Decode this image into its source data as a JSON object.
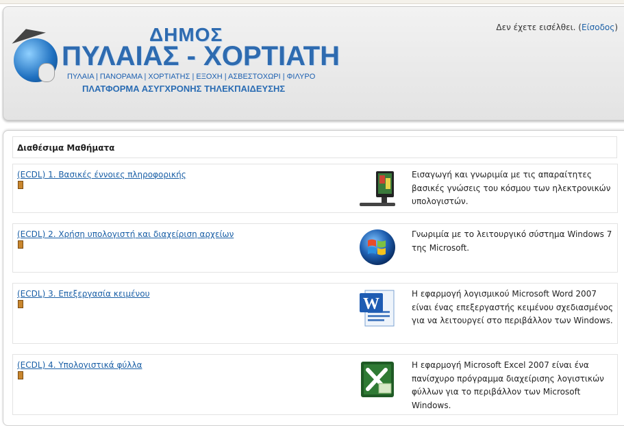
{
  "header": {
    "logo_line1": "ΔΗΜΟΣ",
    "logo_line2": "ΠΥΛΑΙΑΣ - ΧΟΡΤΙΑΤΗ",
    "logo_line3": "ΠΥΛΑΙΑ | ΠΑΝΟΡΑΜΑ | ΧΟΡΤΙΑΤΗΣ | ΕΞΟΧΗ | ΑΣΒΕΣΤΟΧΩΡΙ | ΦΙΛΥΡΟ",
    "logo_line4": "ΠΛΑΤΦΟΡΜΑ ΑΣΥΓΧΡΟΝΗΣ ΤΗΛΕΚΠΑΙΔΕΥΣΗΣ",
    "login_text": "Δεν έχετε εισέλθει. (",
    "login_link": "Είσοδος",
    "login_close": ")"
  },
  "section_title": "Διαθέσιμα Μαθήματα",
  "courses": [
    {
      "title": "(ECDL) 1. Βασικές έννοιες πληροφορικής",
      "icon": "computer-icon",
      "desc": "Εισαγωγή και γνωριμία με τις απαραίτητες βασικές γνώσεις του κόσμου των ηλεκτρονικών υπολογιστών."
    },
    {
      "title": "(ECDL) 2. Χρήση υπολογιστή και διαχείριση αρχείων",
      "icon": "windows-logo-icon",
      "desc": "Γνωριμία με το λειτουργικό σύστημα Windows 7 της Microsoft."
    },
    {
      "title": "(ECDL) 3. Επεξεργασία κειμένου",
      "icon": "word-icon",
      "desc": "Η εφαρμογή λογισμικού Microsoft Word 2007 είναι ένας επεξεργαστής κειμένου σχεδιασμένος για να λειτουργεί στο περιβάλλον των Windows."
    },
    {
      "title": "(ECDL) 4. Υπολογιστικά φύλλα",
      "icon": "excel-icon",
      "desc": "Η εφαρμογή Microsoft Excel 2007 είναι ένα πανίσχυρο πρόγραμμα διαχείρισης λογιστικών φύλλων για το περιβάλλον των Microsoft Windows."
    }
  ]
}
